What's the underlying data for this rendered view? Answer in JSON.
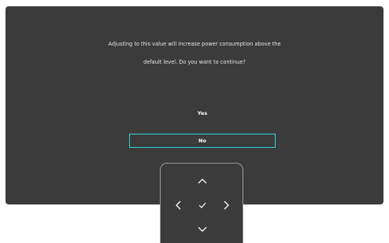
{
  "dialog": {
    "message_line1": "Adjusting to this value will increase power consumption above the",
    "message_line2": "default level. Do you want to continue?",
    "options": [
      {
        "label": "Yes",
        "selected": false
      },
      {
        "label": "No",
        "selected": true
      }
    ]
  },
  "navpad": {
    "buttons": [
      "chevron-up-icon",
      "chevron-left-icon",
      "check-icon",
      "chevron-right-icon",
      "chevron-down-icon"
    ]
  },
  "colors": {
    "dialog_background": "#3b3b3b",
    "text": "#ffffff",
    "selection_accent": "#2fd2d2",
    "navpad_border": "#9a9a9a"
  }
}
